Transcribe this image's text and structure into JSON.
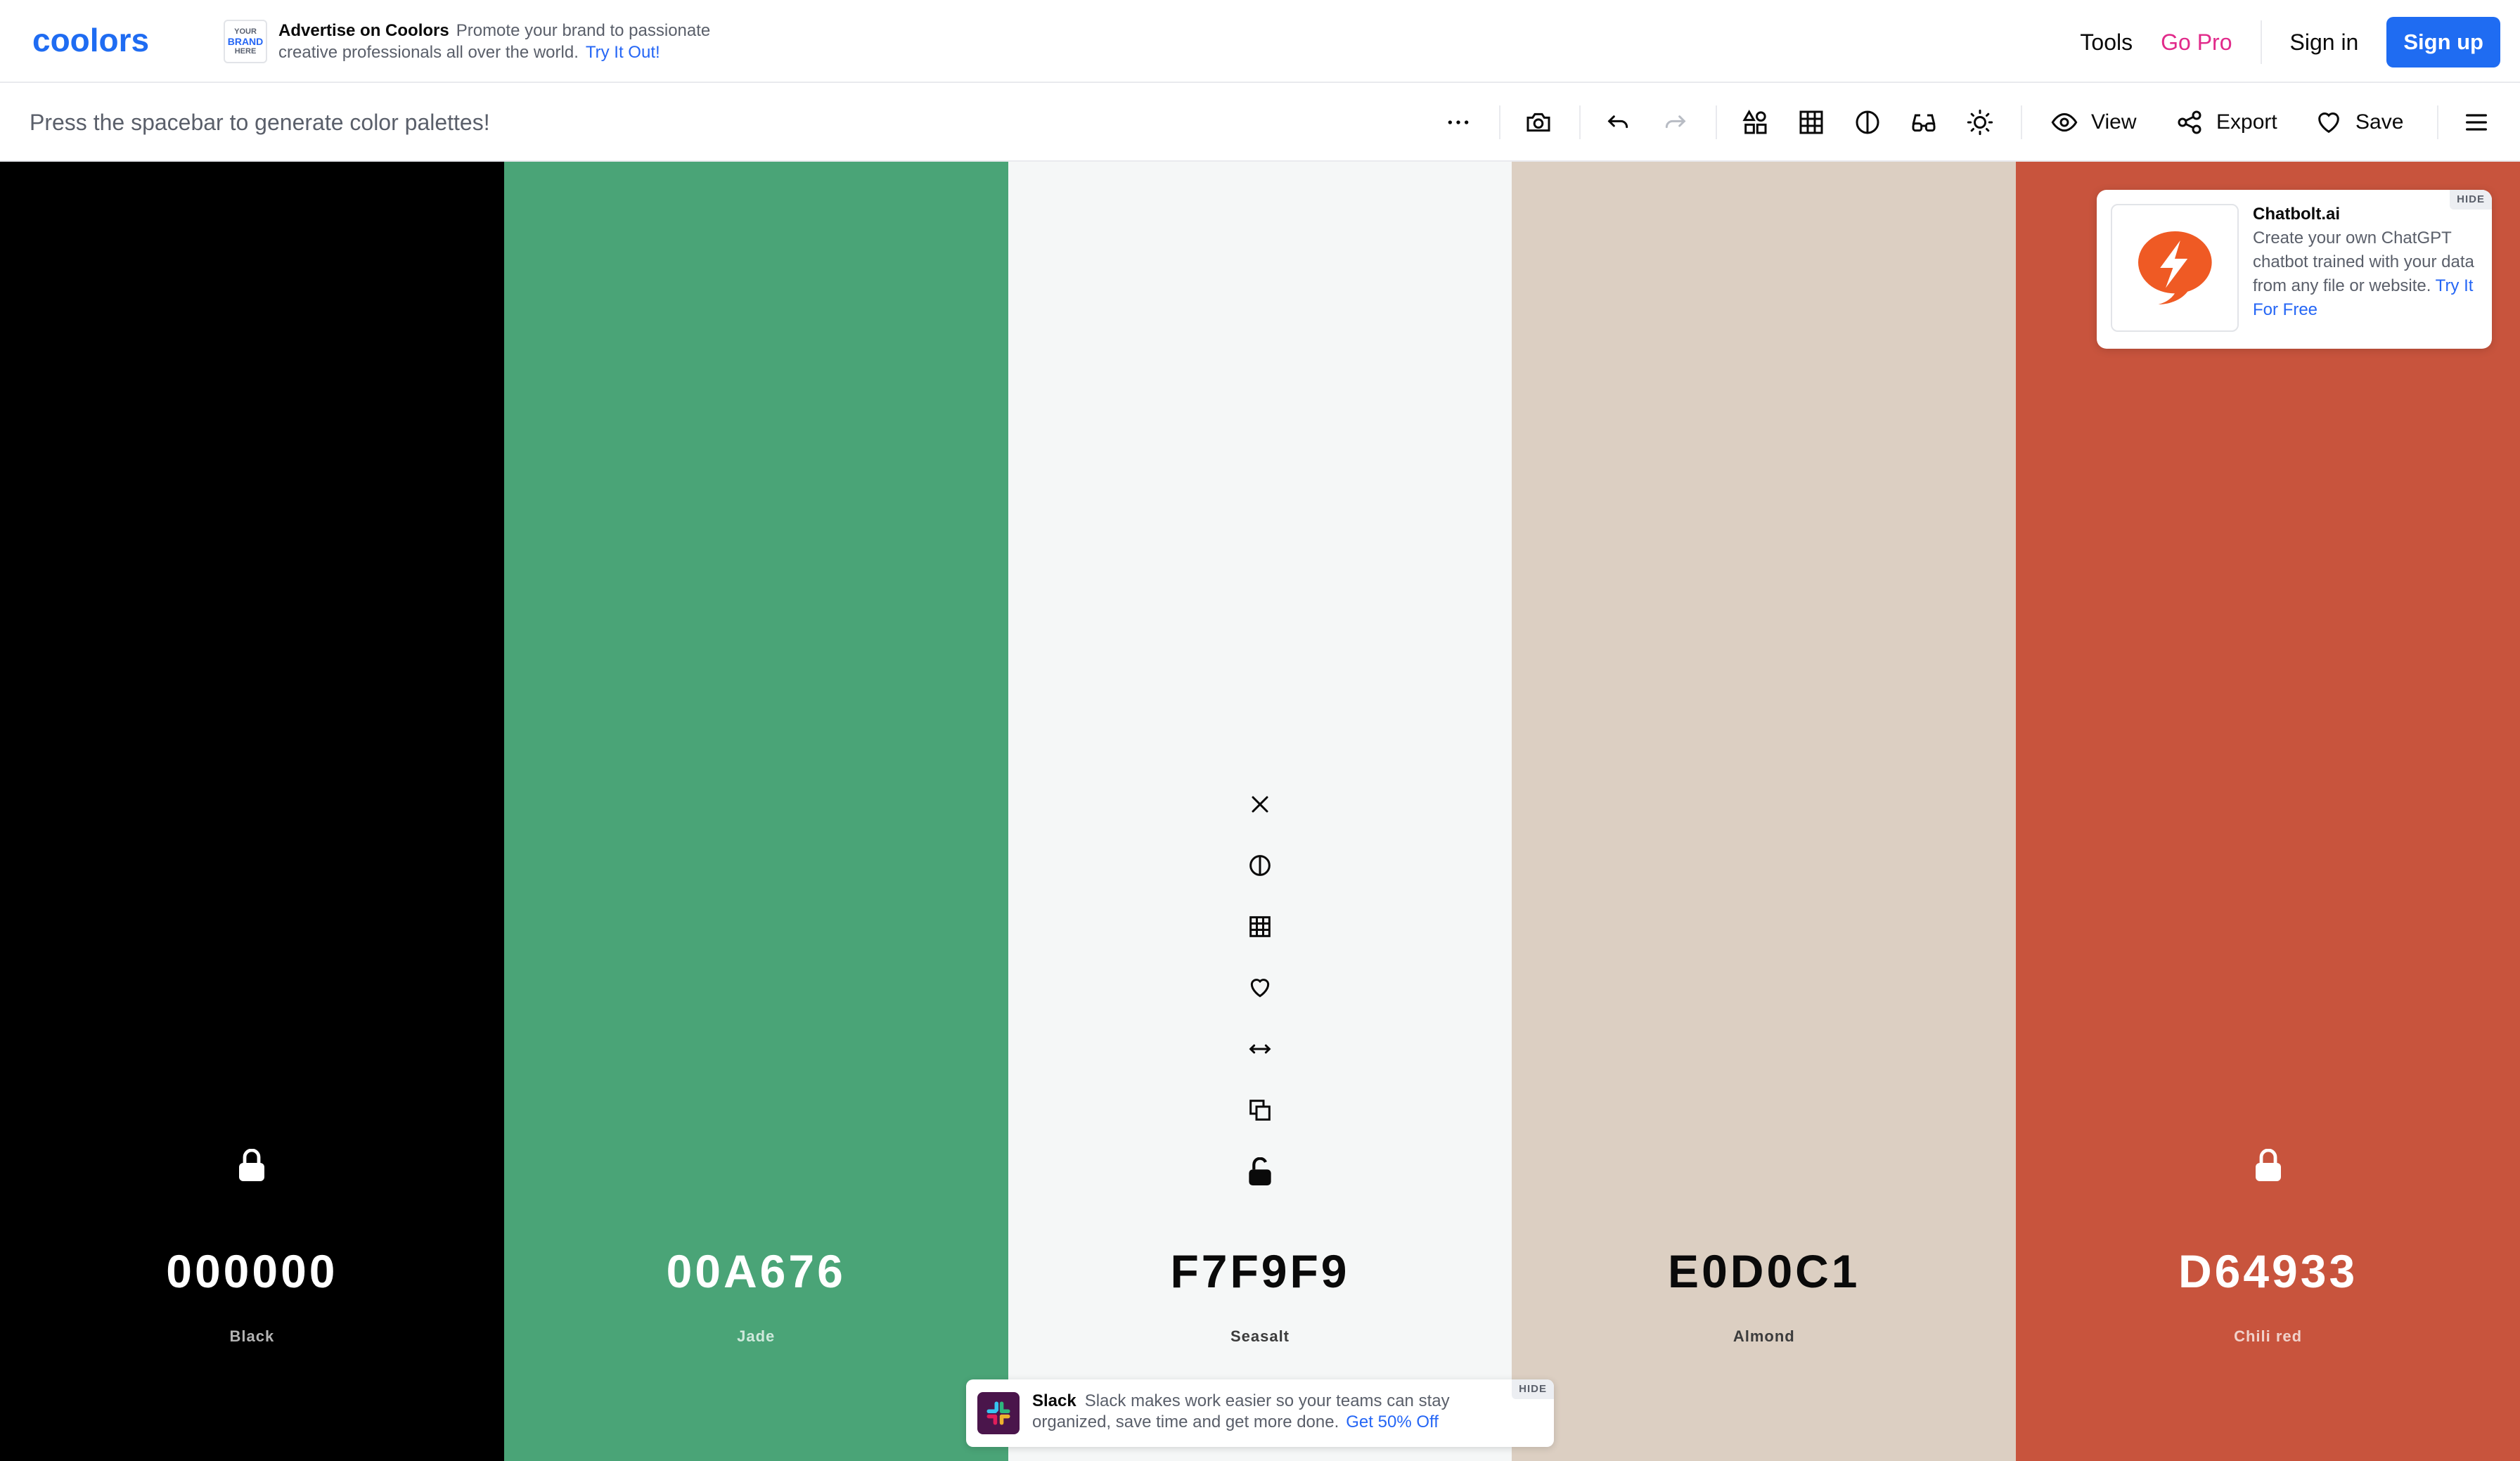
{
  "app": {
    "brand": "coolors"
  },
  "topnav": {
    "ad": {
      "brand_box_line1": "YOUR",
      "brand_box_line2": "BRAND",
      "brand_box_line3": "HERE",
      "title": "Advertise on Coolors",
      "body": "Promote your brand to passionate creative professionals all over the world.",
      "cta": "Try It Out!"
    },
    "links": {
      "tools": "Tools",
      "go_pro": "Go Pro",
      "sign_in": "Sign in",
      "sign_up": "Sign up"
    }
  },
  "toolbar": {
    "hint": "Press the spacebar to generate color palettes!",
    "view_label": "View",
    "export_label": "Export",
    "save_label": "Save",
    "icons": [
      "more-options-icon",
      "camera-icon",
      "undo-icon",
      "redo-icon",
      "shapes-icon",
      "grid-icon",
      "contrast-icon",
      "glasses-icon",
      "brightness-icon",
      "eye-icon",
      "share-icon",
      "heart-icon",
      "hamburger-menu-icon"
    ]
  },
  "palette": {
    "swatches": [
      {
        "hex": "000000",
        "name": "Black",
        "color": "#000000",
        "text_color": "#ffffff",
        "sub_color": "#b3b3b3",
        "locked": true
      },
      {
        "hex": "00A676",
        "name": "Jade",
        "color": "#4aa477",
        "text_color": "#ffffff",
        "sub_color": "#cfe9dc",
        "locked": false
      },
      {
        "hex": "F7F9F9",
        "name": "Seasalt",
        "color": "#f5f7f7",
        "text_color": "#0a0a0a",
        "sub_color": "#3c3c3c",
        "locked": false
      },
      {
        "hex": "E0D0C1",
        "name": "Almond",
        "color": "#dccfc2",
        "text_color": "#0a0a0a",
        "sub_color": "#3c3c3c",
        "locked": false
      },
      {
        "hex": "D64933",
        "name": "Chili red",
        "color": "#c8543d",
        "text_color": "#ffffff",
        "sub_color": "#f1d2cb",
        "locked": true
      }
    ],
    "active_tools": [
      "close-icon",
      "contrast-icon",
      "grid-icon",
      "heart-icon",
      "drag-horizontal-icon",
      "copy-icon",
      "unlock-icon"
    ]
  },
  "ads": {
    "side": {
      "title": "Chatbolt.ai",
      "body": "Create your own ChatGPT chatbot trained with your data from any file or website.",
      "cta": "Try It For Free",
      "hide": "HIDE",
      "accent": "#ef5a24"
    },
    "bottom": {
      "title": "Slack",
      "body": "Slack makes work easier so your teams can stay organized, save time and get more done.",
      "cta": "Get 50% Off",
      "hide": "HIDE"
    }
  },
  "colors": {
    "accent": "#1f6cf2",
    "pro": "#e12a8a"
  }
}
